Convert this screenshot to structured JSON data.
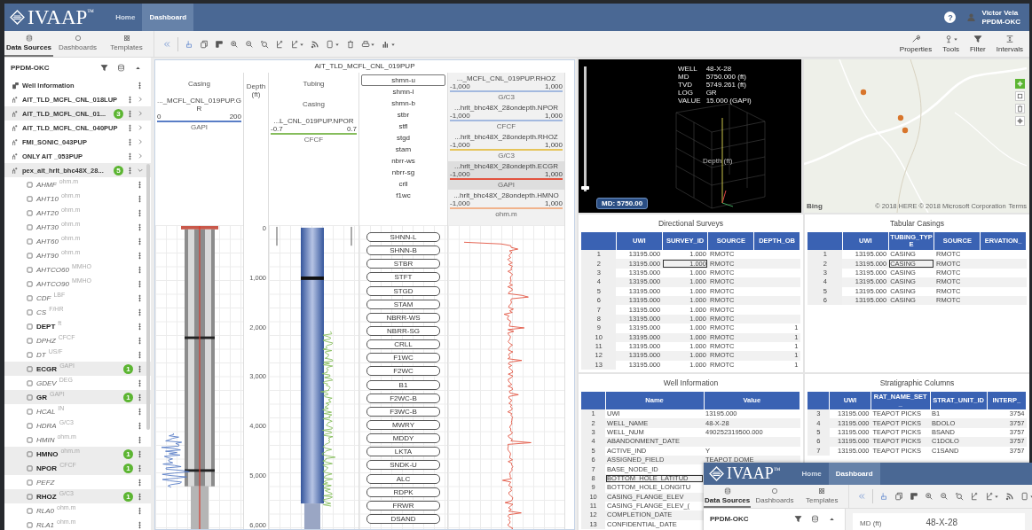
{
  "app": {
    "logo": "IVAAP",
    "trademark": "™",
    "nav": [
      {
        "label": "Home",
        "selected": false
      },
      {
        "label": "Dashboard",
        "selected": true
      }
    ],
    "help": "?",
    "user": {
      "name": "Victor Vela",
      "org": "PPDM-OKC"
    }
  },
  "sidebar": {
    "tabs": [
      {
        "label": "Data Sources",
        "kind": "sources",
        "selected": true
      },
      {
        "label": "Dashboards",
        "kind": "dashboards",
        "selected": false
      },
      {
        "label": "Templates",
        "kind": "templates",
        "selected": false
      }
    ],
    "title": "PPDM-OKC",
    "items": [
      {
        "label": "Well Information",
        "kind": "info",
        "selected": false
      },
      {
        "label": "AIT_TLD_MCFL_CNL_018LUP",
        "kind": "well",
        "selected": false,
        "expanded": false
      },
      {
        "label": "AIT_TLD_MCFL_CNL_01...",
        "kind": "well",
        "count": "3",
        "selected": true,
        "expanded": false
      },
      {
        "label": "AIT_TLD_MCFL_CNL_040PUP",
        "kind": "well",
        "selected": false,
        "expanded": false
      },
      {
        "label": "FMI_SONIC_043PUP",
        "kind": "well",
        "selected": false,
        "expanded": false
      },
      {
        "label": "ONLY AIT _053PUP",
        "kind": "well",
        "selected": false,
        "expanded": false
      },
      {
        "label": "pex_ait_hrlt_bhc48X_28...",
        "kind": "well",
        "count": "5",
        "selected": true,
        "expanded": true,
        "children": [
          {
            "label": "AHMF",
            "unit": "ohm.m",
            "bold": false,
            "selected": false
          },
          {
            "label": "AHT10",
            "unit": "ohm.m",
            "bold": false,
            "selected": false
          },
          {
            "label": "AHT20",
            "unit": "ohm.m",
            "bold": false,
            "selected": false
          },
          {
            "label": "AHT30",
            "unit": "ohm.m",
            "bold": false,
            "selected": false
          },
          {
            "label": "AHT60",
            "unit": "ohm.m",
            "bold": false,
            "selected": false
          },
          {
            "label": "AHT90",
            "unit": "ohm.m",
            "bold": false,
            "selected": false
          },
          {
            "label": "AHTCO60",
            "unit": "MMHO",
            "bold": false,
            "selected": false
          },
          {
            "label": "AHTCO90",
            "unit": "MMHO",
            "bold": false,
            "selected": false
          },
          {
            "label": "CDF",
            "unit": "LBF",
            "bold": false,
            "selected": false
          },
          {
            "label": "CS",
            "unit": "F/HR",
            "bold": false,
            "selected": false
          },
          {
            "label": "DEPT",
            "unit": "ft",
            "bold": true,
            "selected": false
          },
          {
            "label": "DPHZ",
            "unit": "CFCF",
            "bold": false,
            "selected": false
          },
          {
            "label": "DT",
            "unit": "US/F",
            "bold": false,
            "selected": false
          },
          {
            "label": "ECGR",
            "unit": "GAPI",
            "bold": true,
            "selected": true,
            "count": "1"
          },
          {
            "label": "GDEV",
            "unit": "DEG",
            "bold": false,
            "selected": false
          },
          {
            "label": "GR",
            "unit": "GAPI",
            "bold": true,
            "selected": true,
            "count": "1"
          },
          {
            "label": "HCAL",
            "unit": "IN",
            "bold": false,
            "selected": false
          },
          {
            "label": "HDRA",
            "unit": "G/C3",
            "bold": false,
            "selected": false
          },
          {
            "label": "HMIN",
            "unit": "ohm.m",
            "bold": false,
            "selected": false
          },
          {
            "label": "HMNO",
            "unit": "ohm.m",
            "bold": true,
            "selected": true,
            "count": "1"
          },
          {
            "label": "NPOR",
            "unit": "CFCF",
            "bold": true,
            "selected": true,
            "count": "1"
          },
          {
            "label": "PEFZ",
            "bold": false,
            "selected": false
          },
          {
            "label": "RHOZ",
            "unit": "G/C3",
            "bold": true,
            "selected": true,
            "count": "1"
          },
          {
            "label": "RLA0",
            "unit": "ohm.m",
            "bold": false,
            "selected": false
          },
          {
            "label": "RLA1",
            "unit": "ohm.m",
            "bold": false,
            "selected": false
          }
        ]
      }
    ]
  },
  "toolbar": {
    "tools": [
      {
        "label": "Properties",
        "kind": "properties",
        "menu": false
      },
      {
        "label": "Tools",
        "kind": "tools",
        "menu": true
      },
      {
        "label": "Filter",
        "kind": "filter",
        "menu": false
      },
      {
        "label": "Intervals",
        "kind": "intervals",
        "menu": false
      }
    ]
  },
  "log_view": {
    "title": "AIT_TLD_MCFL_CNL_019PUP",
    "tracks": [
      {
        "kind": "casing",
        "titles": [
          "Casing"
        ],
        "curves": [
          {
            "min": "0",
            "name": "..._MCFL_CNL_019PUP.GR",
            "max": "200",
            "unit": "GAPI",
            "color": "#5a7ec6"
          }
        ]
      },
      {
        "kind": "depth",
        "titles": [
          "Depth (ft)"
        ],
        "ticks": [
          "0",
          "1,000",
          "2,000",
          "3,000",
          "4,000",
          "5,000",
          "6,000"
        ]
      },
      {
        "kind": "tubing",
        "titles": [
          "Tubing",
          "Casing"
        ],
        "curves": [
          {
            "min": "-0.7",
            "name": "...L_CNL_019PUP.NPOR",
            "max": "0.7",
            "unit": "CFCF",
            "color": "#86bd5c"
          }
        ]
      },
      {
        "kind": "formations",
        "options": [
          {
            "label": "shmn-u",
            "selected": true
          },
          {
            "label": "shmn-l",
            "selected": false
          },
          {
            "label": "shmn-b",
            "selected": false
          },
          {
            "label": "stbr",
            "selected": false
          },
          {
            "label": "stfl",
            "selected": false
          },
          {
            "label": "stgd",
            "selected": false
          },
          {
            "label": "stam",
            "selected": false
          },
          {
            "label": "nbrr-ws",
            "selected": false
          },
          {
            "label": "nbrr-sg",
            "selected": false
          },
          {
            "label": "crll",
            "selected": false
          },
          {
            "label": "f1wc",
            "selected": false
          }
        ],
        "tops": [
          "SHNN-L",
          "SHNN-B",
          "STBR",
          "STFT",
          "STGD",
          "STAM",
          "NBRR-WS",
          "NBRR-SG",
          "CRLL",
          "F1WC",
          "F2WC",
          "B1",
          "F2WC-B",
          "F3WC-B",
          "MWRY",
          "MDDY",
          "LKTA",
          "SNDK-U",
          "ALC",
          "RDPK",
          "FRWR",
          "DSAND"
        ]
      },
      {
        "kind": "curves",
        "curves": [
          {
            "min": "-1,000",
            "name": "..._MCFL_CNL_019PUP.RHOZ",
            "max": "1,000",
            "unit": "G/C3",
            "color": "#a3b9df",
            "selected": false
          },
          {
            "min": "-1,000",
            "name": "...hrlt_bhc48X_28ondepth.NPOR",
            "max": "1,000",
            "unit": "CFCF",
            "color": "#a3b9df",
            "selected": false
          },
          {
            "min": "-1,000",
            "name": "...hrlt_bhc48X_28ondepth.RHOZ",
            "max": "1,000",
            "unit": "G/C3",
            "color": "#e6c45a",
            "selected": false
          },
          {
            "min": "-1,000",
            "name": "...hrlt_bhc48X_28ondepth.ECGR",
            "max": "1,000",
            "unit": "GAPI",
            "color": "#e2533f",
            "selected": true
          },
          {
            "min": "-1,000",
            "name": "...hrlt_bhc48X_28ondepth.HMNO",
            "max": "1,000",
            "unit": "ohm.m",
            "color": "#f1b38c",
            "selected": false
          }
        ]
      }
    ]
  },
  "view_3d": {
    "info": [
      {
        "label": "WELL",
        "value": "48-X-28"
      },
      {
        "label": "MD",
        "value": "5750.000 (ft)"
      },
      {
        "label": "TVD",
        "value": "5749.261 (ft)"
      },
      {
        "label": "LOG",
        "value": "GR"
      },
      {
        "label": "VALUE",
        "value": "15.000 (GAPI)"
      }
    ],
    "axis_label": "Depth (ft)",
    "md_button": "MD: 5750.00",
    "slider": {
      "level": 0.03
    }
  },
  "map": {
    "provider": "Bing",
    "attribution": "© 2018 HERE © 2018 Microsoft Corporation",
    "terms": "Terms"
  },
  "tables": [
    {
      "title": "Directional Surveys",
      "kind": "surveys",
      "columns": [
        {},
        {
          "label": "UWI"
        },
        {
          "label": "SURVEY_ID"
        },
        {
          "label": "SOURCE"
        },
        {
          "label": "DEPTH_OB"
        }
      ],
      "rows": [
        [
          "1",
          "13195.000",
          "1.000",
          "RMOTC",
          null
        ],
        [
          "2",
          "13195.000",
          {
            "text": "1.000",
            "focused": true
          },
          "RMOTC",
          null
        ],
        [
          "3",
          "13195.000",
          "1.000",
          "RMOTC",
          null
        ],
        [
          "4",
          "13195.000",
          "1.000",
          "RMOTC",
          null
        ],
        [
          "5",
          "13195.000",
          "1.000",
          "RMOTC",
          null
        ],
        [
          "6",
          "13195.000",
          "1.000",
          "RMOTC",
          null
        ],
        [
          "7",
          "13195.000",
          "1.000",
          "RMOTC",
          null
        ],
        [
          "8",
          "13195.000",
          "1.000",
          "RMOTC",
          null
        ],
        [
          "9",
          "13195.000",
          "1.000",
          "RMOTC",
          "1"
        ],
        [
          "10",
          "13195.000",
          "1.000",
          "RMOTC",
          "1"
        ],
        [
          "11",
          "13195.000",
          "1.000",
          "RMOTC",
          "1"
        ],
        [
          "12",
          "13195.000",
          "1.000",
          "RMOTC",
          "1"
        ],
        [
          "13",
          "13195.000",
          "1.000",
          "RMOTC",
          "1"
        ]
      ]
    },
    {
      "title": "Tabular Casings",
      "kind": "casings",
      "columns": [
        {},
        {
          "label": "UWI"
        },
        {
          "label": "TUBING_TYPE"
        },
        {
          "label": "SOURCE"
        },
        {
          "label": "ERVATION_"
        }
      ],
      "rows": [
        [
          "1",
          "13195.000",
          "CASING",
          "RMOTC",
          null
        ],
        [
          "2",
          "13195.000",
          {
            "text": "CASING",
            "focused": true
          },
          "RMOTC",
          null
        ],
        [
          "3",
          "13195.000",
          "CASING",
          "RMOTC",
          null
        ],
        [
          "4",
          "13195.000",
          "CASING",
          "RMOTC",
          null
        ],
        [
          "5",
          "13195.000",
          "CASING",
          "RMOTC",
          null
        ],
        [
          "6",
          "13195.000",
          "CASING",
          "RMOTC",
          null
        ]
      ]
    },
    {
      "title": "Well Information",
      "kind": "wellinfo",
      "columns": [
        {},
        {
          "label": "Name"
        },
        {
          "label": "Value"
        }
      ],
      "rows": [
        [
          "1",
          "UWI",
          "13195.000"
        ],
        [
          "2",
          "WELL_NAME",
          "48-X-28"
        ],
        [
          "3",
          "WELL_NUM",
          "490252319500.000"
        ],
        [
          "4",
          "ABANDONMENT_DATE",
          null
        ],
        [
          "5",
          "ACTIVE_IND",
          "Y"
        ],
        [
          "6",
          "ASSIGNED_FIELD",
          "TEAPOT DOME"
        ],
        [
          "7",
          "BASE_NODE_ID",
          null
        ],
        [
          "8",
          {
            "text": "BOTTOM_HOLE_LATITUD",
            "focused": true
          },
          null
        ],
        [
          "9",
          "BOTTOM_HOLE_LONGITU",
          null
        ],
        [
          "10",
          "CASING_FLANGE_ELEV",
          null
        ],
        [
          "11",
          "CASING_FLANGE_ELEV_(",
          null
        ],
        [
          "12",
          "COMPLETION_DATE",
          null
        ],
        [
          "13",
          "CONFIDENTIAL_DATE",
          null
        ]
      ]
    },
    {
      "title": "Stratigraphic Columns",
      "kind": "strat",
      "columns": [
        {},
        {
          "label": "UWI"
        },
        {
          "label": "RAT_NAME_SET_"
        },
        {
          "label": "STRAT_UNIT_ID"
        },
        {
          "label": "INTERP_"
        }
      ],
      "rows": [
        [
          "3",
          "13195.000",
          "TEAPOT PICKS",
          "B1",
          "3754"
        ],
        [
          "4",
          "13195.000",
          "TEAPOT PICKS",
          "BDOLO",
          "3757"
        ],
        [
          "5",
          "13195.000",
          "TEAPOT PICKS",
          "BSAND",
          "3757"
        ],
        [
          "6",
          "13195.000",
          "TEAPOT PICKS",
          "C1DOLO",
          "3757"
        ],
        [
          "7",
          "13195.000",
          "TEAPOT PICKS",
          "C1SAND",
          "3757"
        ]
      ]
    }
  ],
  "inset_window": {
    "logo": "IVAAP",
    "trademark": "™",
    "nav": [
      {
        "label": "Home",
        "selected": false
      },
      {
        "label": "Dashboard",
        "selected": true
      }
    ],
    "tabs": [
      {
        "label": "Data Sources",
        "kind": "sources",
        "selected": true
      },
      {
        "label": "Dashboards",
        "kind": "dashboards",
        "selected": false
      },
      {
        "label": "Templates",
        "kind": "templates",
        "selected": false
      }
    ],
    "title": "PPDM-OKC",
    "depth_label": "MD (ft)",
    "well": "48-X-28"
  }
}
